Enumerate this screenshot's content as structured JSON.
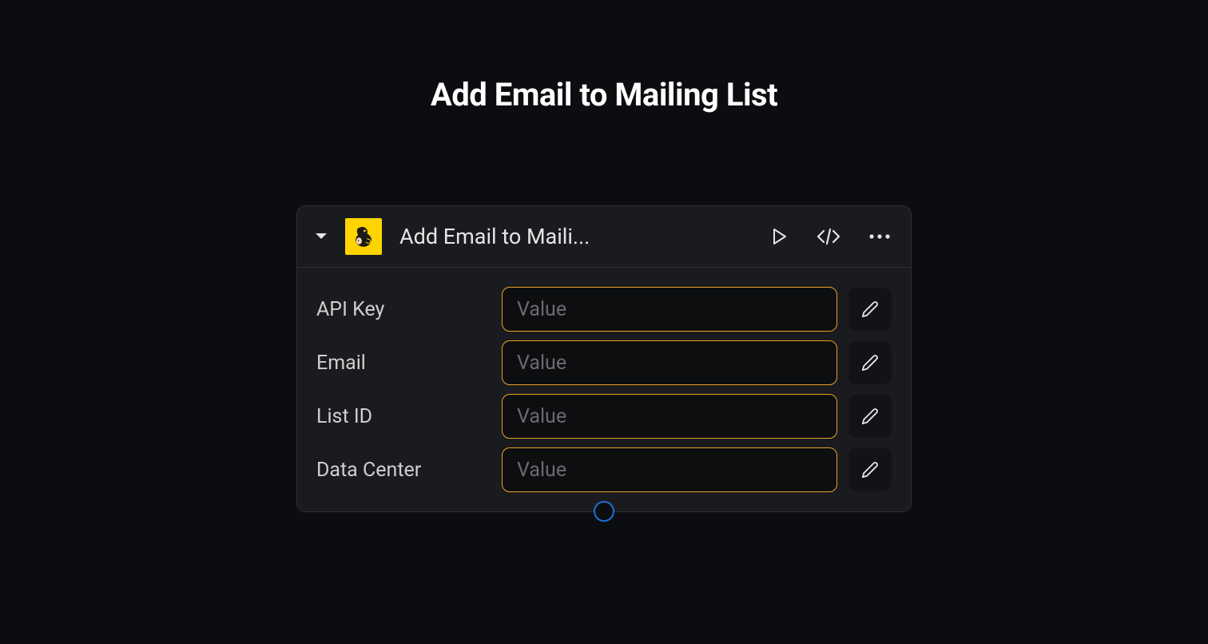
{
  "page": {
    "title": "Add Email to Mailing List"
  },
  "node": {
    "title": "Add Email to Maili...",
    "icon_name": "mailchimp-icon",
    "fields": [
      {
        "label": "API Key",
        "placeholder": "Value",
        "value": ""
      },
      {
        "label": "Email",
        "placeholder": "Value",
        "value": ""
      },
      {
        "label": "List ID",
        "placeholder": "Value",
        "value": ""
      },
      {
        "label": "Data Center",
        "placeholder": "Value",
        "value": ""
      }
    ],
    "actions": {
      "run": "Run",
      "code": "Code",
      "more": "More"
    }
  }
}
